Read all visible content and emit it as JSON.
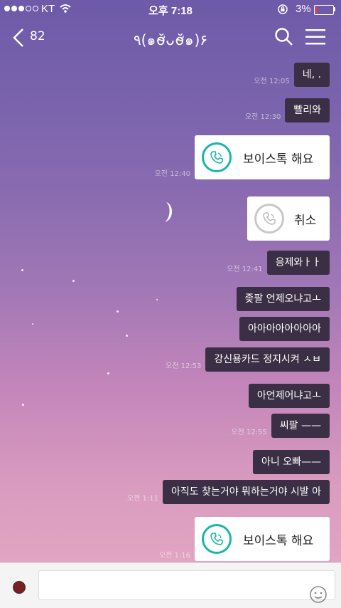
{
  "status_bar": {
    "carrier": "KT",
    "time": "오후 7:18",
    "battery": "3%",
    "battery_level": 0.03
  },
  "header": {
    "back_count": "82",
    "title": "٩(๑ơ̴̆ᴗơ̴̆๑)۶"
  },
  "messages": [
    {
      "type": "text",
      "text": "네, .",
      "time": "오전 12:05"
    },
    {
      "type": "text",
      "text": "빨리와",
      "time": "오전 12:30"
    },
    {
      "type": "call",
      "label": "보이스톡 해요",
      "time": "오전 12:40",
      "style": "active"
    },
    {
      "type": "call",
      "label": "취소",
      "time": "",
      "style": "cancelled"
    },
    {
      "type": "text",
      "text": "응제와ㅏㅏ",
      "time": "오전 12:41"
    },
    {
      "type": "text",
      "text": "좆팔 언제오냐고ㅗ",
      "time": ""
    },
    {
      "type": "text",
      "text": "아아아아아아아아",
      "time": ""
    },
    {
      "type": "text",
      "text": "강신용카드 정지시켜 ㅅㅂ",
      "time": "오전 12:53"
    },
    {
      "type": "text",
      "text": "아언제어냐고ㅗ",
      "time": ""
    },
    {
      "type": "text",
      "text": "씨팔 ——",
      "time": "오전 12:55"
    },
    {
      "type": "text",
      "text": "아니 오빠——",
      "time": ""
    },
    {
      "type": "text",
      "text": "아직도 찾는거야 뭐하는거야 시발 아",
      "time": "오전 1:11"
    },
    {
      "type": "call",
      "label": "보이스톡 해요",
      "time": "오전 1:16",
      "style": "active"
    }
  ],
  "colors": {
    "call_accent": "#1bb5ac",
    "bubble_bg": "#3a2f44"
  },
  "icons": [
    "back-icon",
    "search-icon",
    "menu-icon",
    "phone-icon",
    "emoji-icon",
    "hash-icon",
    "lock-rotation-icon",
    "wifi-icon"
  ]
}
